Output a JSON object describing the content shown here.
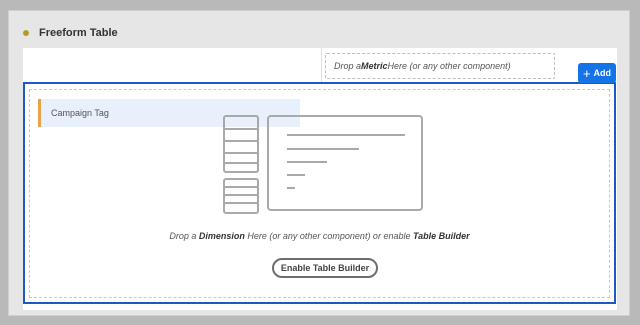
{
  "panel": {
    "title": "Freeform Table"
  },
  "metric_dropzone": {
    "prefix": "Drop a ",
    "keyword": "Metric",
    "suffix": " Here (or any other component)"
  },
  "add_button": {
    "label": "Add",
    "icon": "plus-icon"
  },
  "campaign_tag": {
    "label": "Campaign Tag"
  },
  "dimension_dropzone": {
    "prefix": "Drop a ",
    "keyword": "Dimension",
    "middle": " Here (or any other component) or enable ",
    "keyword2": "Table Builder"
  },
  "enable_button": {
    "label": "Enable Table Builder"
  },
  "colors": {
    "accent": "#1473e6",
    "selection_border": "#1b59c8",
    "status_dot": "#b59a2a",
    "chip_marker": "#e8a24a"
  }
}
